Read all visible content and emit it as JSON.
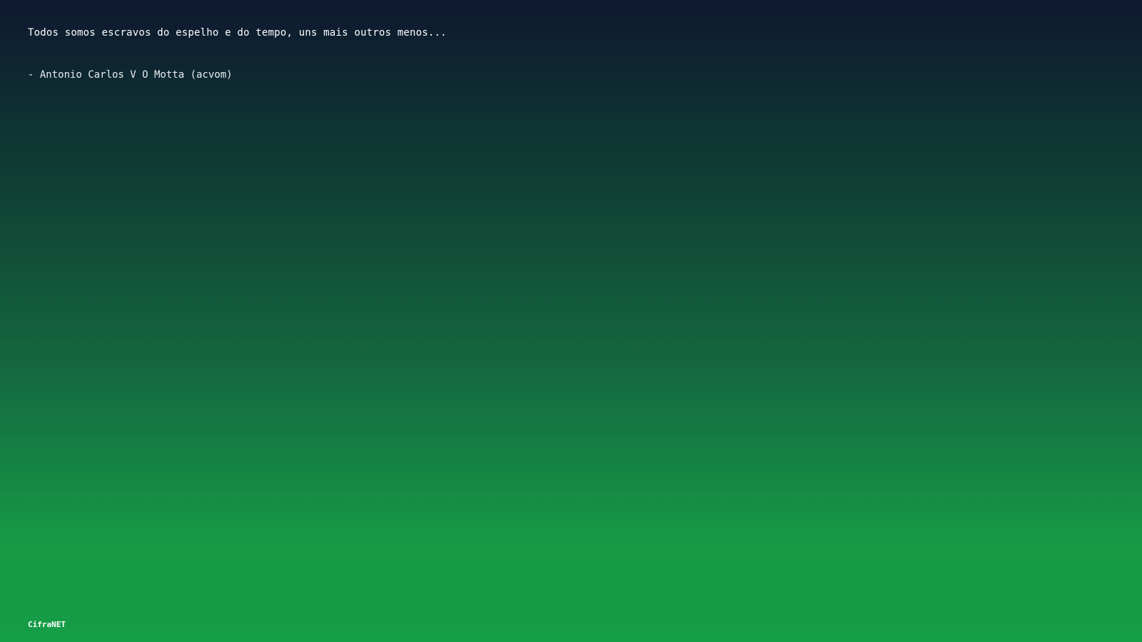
{
  "quote": {
    "text": "Todos somos escravos do espelho e do tempo, uns mais outros menos...",
    "author": "- Antonio Carlos V O Motta (acvom)"
  },
  "footer": {
    "brand": "CifraNET"
  },
  "colors": {
    "background_top": "#0e1830",
    "background_bottom": "#169d47",
    "text": "#ffffff"
  }
}
